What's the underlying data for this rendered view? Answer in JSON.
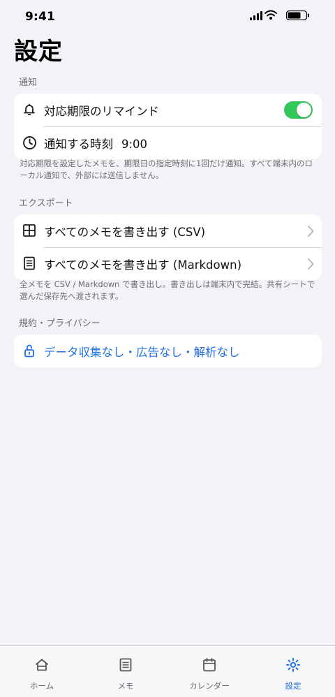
{
  "status_bar": {
    "time": "9:41"
  },
  "page": {
    "title": "設定"
  },
  "sections": {
    "notifications": {
      "header": "通知",
      "remind_label": "対応期限のリマインド",
      "remind_enabled": true,
      "time_label": "通知する時刻",
      "time_value": "9:00",
      "footnote": "対応期限を設定したメモを、期限日の指定時刻に1回だけ通知。すべて端末内のローカル通知で、外部には送信しません。"
    },
    "export": {
      "header": "エクスポート",
      "csv_label": "すべてのメモを書き出す (CSV)",
      "markdown_label": "すべてのメモを書き出す (Markdown)",
      "footnote": "全メモを CSV / Markdown で書き出し。書き出しは端末内で完結。共有シートで選んだ保存先へ渡されます。"
    },
    "privacy": {
      "header": "規約・プライバシー",
      "label": "データ収集なし・広告なし・解析なし"
    }
  },
  "tabbar": {
    "items": [
      {
        "label": "ホーム",
        "icon": "home-icon"
      },
      {
        "label": "メモ",
        "icon": "memo-icon"
      },
      {
        "label": "カレンダー",
        "icon": "calendar-icon"
      },
      {
        "label": "設定",
        "icon": "gear-icon"
      }
    ],
    "active_index": 3
  },
  "colors": {
    "accent": "#1f6fe5",
    "toggle_on": "#34c759",
    "background": "#f2f2f7",
    "secondary_text": "#6d6d72"
  }
}
